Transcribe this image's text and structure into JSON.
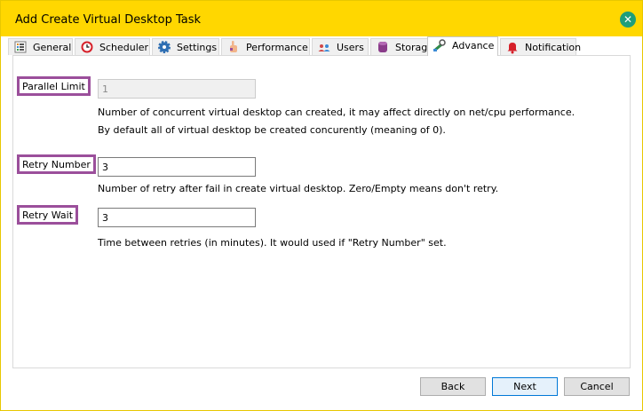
{
  "window": {
    "title": "Add Create Virtual Desktop Task"
  },
  "tabs": [
    {
      "label": "General",
      "icon": "list-icon"
    },
    {
      "label": "Scheduler",
      "icon": "clock-icon"
    },
    {
      "label": "Settings",
      "icon": "gear-icon"
    },
    {
      "label": "Performance",
      "icon": "hand-icon"
    },
    {
      "label": "Users",
      "icon": "users-icon"
    },
    {
      "label": "Storage",
      "icon": "database-icon"
    },
    {
      "label": "Advance",
      "icon": "tools-icon",
      "active": true
    },
    {
      "label": "Notification",
      "icon": "bell-icon"
    }
  ],
  "fields": {
    "parallel_limit": {
      "label": "Parallel Limit",
      "value": "1",
      "enabled": false,
      "hint1": "Number of concurrent virtual desktop can created, it may affect directly on net/cpu performance.",
      "hint2": "By default all of virtual desktop be created concurently (meaning of 0)."
    },
    "retry_number": {
      "label": "Retry Number",
      "value": "3",
      "hint": "Number of retry after fail in create virtual desktop. Zero/Empty means don't retry."
    },
    "retry_wait": {
      "label": "Retry Wait",
      "value": "3",
      "hint": "Time between retries (in minutes). It would used if \"Retry Number\" set."
    }
  },
  "buttons": {
    "back": "Back",
    "next": "Next",
    "cancel": "Cancel"
  },
  "colors": {
    "titlebar": "#ffd700",
    "label_border": "#9b4f9b",
    "close": "#1f9e7a"
  }
}
